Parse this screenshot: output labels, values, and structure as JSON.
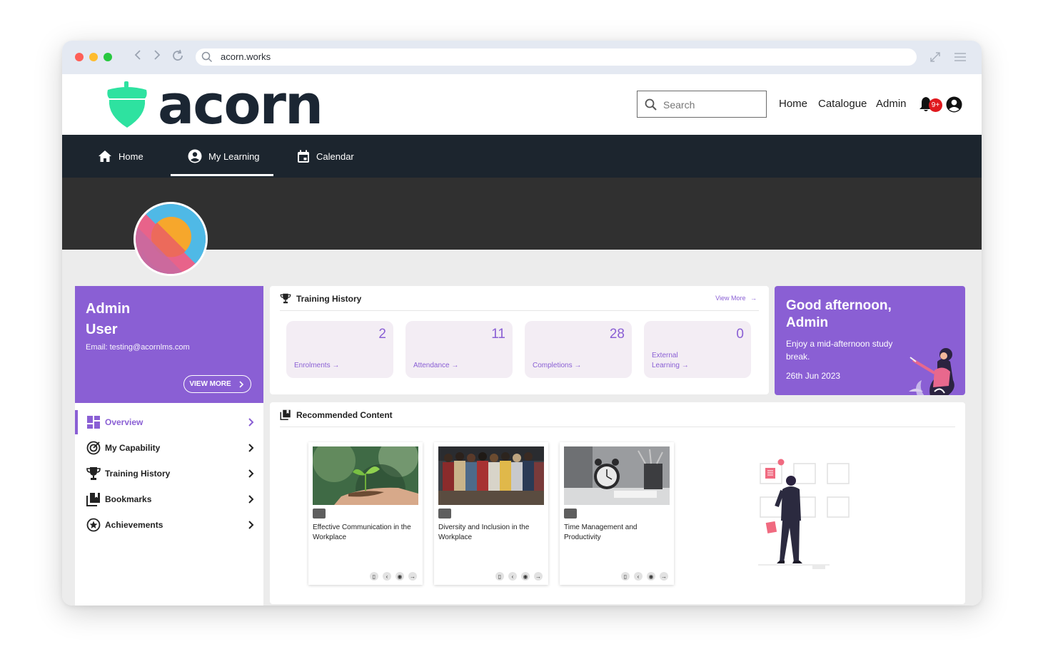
{
  "browser": {
    "url": "acorn.works",
    "colors": {
      "close": "#fe5f57",
      "minimize": "#febc2e",
      "maximize": "#28c840"
    }
  },
  "header": {
    "logo_text": "acorn",
    "search_placeholder": "Search",
    "links": [
      "Home",
      "Catalogue",
      "Admin"
    ],
    "notification_badge": "9+"
  },
  "nav": {
    "items": [
      {
        "label": "Home",
        "icon": "home-icon"
      },
      {
        "label": "My Learning",
        "icon": "user-circle-icon",
        "active": true
      },
      {
        "label": "Calendar",
        "icon": "calendar-icon"
      }
    ]
  },
  "user": {
    "name": "Admin User",
    "first": "Admin",
    "last": "User",
    "email": "Email: testing@acornlms.com",
    "view_more": "VIEW MORE"
  },
  "side_menu": {
    "items": [
      {
        "label": "Overview",
        "icon": "dashboard-icon",
        "active": true
      },
      {
        "label": "My Capability",
        "icon": "target-icon"
      },
      {
        "label": "Training History",
        "icon": "trophy-icon"
      },
      {
        "label": "Bookmarks",
        "icon": "bookmarks-icon"
      },
      {
        "label": "Achievements",
        "icon": "star-circle-icon"
      }
    ]
  },
  "training": {
    "title": "Training History",
    "view_more": "View More",
    "stats": [
      {
        "value": "2",
        "label": "Enrolments"
      },
      {
        "value": "11",
        "label": "Attendance"
      },
      {
        "value": "28",
        "label": "Completions"
      },
      {
        "value": "0",
        "label": "External Learning"
      }
    ]
  },
  "greeting": {
    "title": "Good afternoon, Admin",
    "subtitle": "Enjoy a mid-afternoon study break.",
    "date": "26th Jun 2023"
  },
  "recommended": {
    "title": "Recommended Content",
    "courses": [
      {
        "title": "Effective Communication in the Workplace"
      },
      {
        "title": "Diversity and Inclusion in the Workplace"
      },
      {
        "title": "Time Management and Productivity"
      }
    ]
  },
  "colors": {
    "accent": "#8a5fd4",
    "nav_bg": "#1c252e",
    "banner_bg": "#303030",
    "logo_green": "#2ee2a0"
  }
}
